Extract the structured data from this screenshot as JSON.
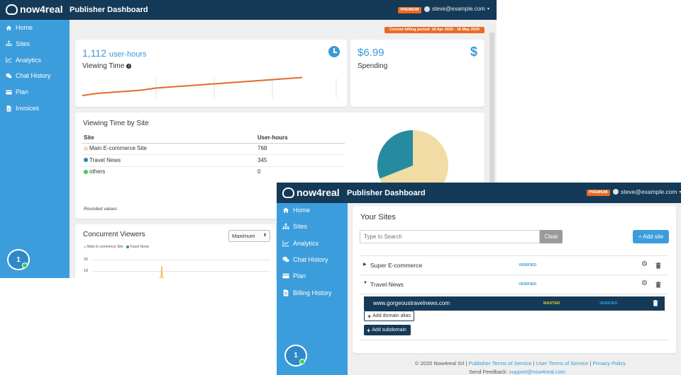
{
  "colors": {
    "topbar": "#143a57",
    "sidebar": "#3b9ddc",
    "accent": "#3b9ddc",
    "premium": "#e86a23",
    "verified": "#3aa0d8",
    "master": "#e5c72c",
    "line": "#e06c2a",
    "pie_main": "#f0dca4",
    "pie_travel": "#268aa0",
    "pie_others": "#3ccf4e"
  },
  "w1": {
    "brand": "now4real",
    "title": "Publisher Dashboard",
    "premium": "PREMIUM",
    "user": "steve@example.com",
    "nav": [
      {
        "label": "Home",
        "icon": "home-icon"
      },
      {
        "label": "Sites",
        "icon": "sitemap-icon"
      },
      {
        "label": "Analytics",
        "icon": "chart-icon"
      },
      {
        "label": "Chat History",
        "icon": "chat-icon"
      },
      {
        "label": "Plan",
        "icon": "plan-icon"
      },
      {
        "label": "Invoices",
        "icon": "file-icon"
      }
    ],
    "billing": "Current billing period: 18 Apr 2020 - 18 May 2020",
    "viewing": {
      "value": "1,112",
      "unit": "user-hours",
      "label": "Viewing Time"
    },
    "spending": {
      "value": "$6.99",
      "label": "Spending"
    },
    "by_site": {
      "title": "Viewing Time by Site",
      "col_site": "Site",
      "col_hours": "User-hours",
      "rows": [
        {
          "name": "Main E-commerce Site",
          "hours": "768"
        },
        {
          "name": "Travel News",
          "hours": "345"
        },
        {
          "name": "others",
          "hours": "0"
        }
      ],
      "footnote": "Rounded values"
    },
    "concurrent": {
      "title": "Concurrent Viewers",
      "select": "Maximum",
      "legend": [
        "Main E-commerce Site",
        "Travel News"
      ],
      "ticks": [
        "20",
        "18"
      ]
    },
    "bubble_count": "1"
  },
  "w2": {
    "brand": "now4real",
    "title": "Publisher Dashboard",
    "premium": "PREMIUM",
    "user": "steve@example.com",
    "nav": [
      {
        "label": "Home",
        "icon": "home-icon"
      },
      {
        "label": "Sites",
        "icon": "sitemap-icon"
      },
      {
        "label": "Analytics",
        "icon": "chart-icon"
      },
      {
        "label": "Chat History",
        "icon": "chat-icon"
      },
      {
        "label": "Plan",
        "icon": "plan-icon"
      },
      {
        "label": "Billing History",
        "icon": "file-icon"
      }
    ],
    "your_sites": "Your Sites",
    "search_placeholder": "Type to Search",
    "clear": "Clear",
    "add_site": "+ Add site",
    "sites": [
      {
        "name": "Super E-commerce",
        "status": "VERIFIED",
        "expanded": false
      },
      {
        "name": "Travel News",
        "status": "VERIFIED",
        "expanded": true
      }
    ],
    "domain": {
      "url": "www.gorgeoustravelnews.com",
      "role": "MASTER",
      "status": "VERIFIED"
    },
    "add_alias": "Add domain alias",
    "add_subdomain": "Add subdomain",
    "footer": {
      "copyright": "© 2020 Now4real Srl |",
      "publisher_terms": "Publisher Terms of Service",
      "sep1": "|",
      "user_terms": "User Terms of Service",
      "sep2": "|",
      "privacy": "Privacy Policy",
      "feedback_label": "Send Feedback:",
      "feedback_email": "support@now4real.com"
    },
    "bubble_count": "1"
  },
  "chart_data": [
    {
      "type": "pie",
      "categories": [
        "Main E-commerce Site",
        "Travel News",
        "others"
      ],
      "values": [
        768,
        345,
        0
      ]
    },
    {
      "type": "line",
      "x": [
        0,
        1,
        2,
        3,
        4,
        5,
        6,
        7,
        8,
        9,
        10,
        11,
        12,
        13,
        14,
        15
      ],
      "values": [
        2,
        4,
        5,
        6,
        7,
        9,
        10,
        11,
        12,
        13,
        14,
        15,
        16,
        17,
        18,
        19
      ],
      "ylim": [
        0,
        40
      ]
    }
  ]
}
